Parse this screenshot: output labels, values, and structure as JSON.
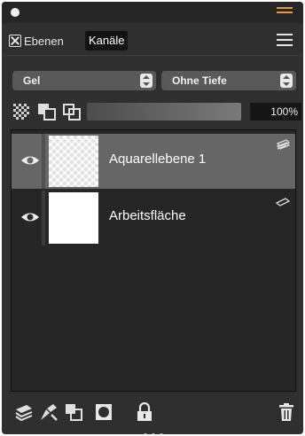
{
  "tabs": {
    "ebenen_label": "Ebenen",
    "kanaele_label": "Kanäle"
  },
  "blend": {
    "mode_value": "Gel",
    "depth_value": "Ohne Tiefe"
  },
  "opacity": {
    "value_label": "100%",
    "value": 100
  },
  "layers": [
    {
      "name": "Aquarellebene 1",
      "selected": true,
      "visible": true,
      "type_icon": "watercolor-layer-icon"
    },
    {
      "name": "Arbeitsfläche",
      "selected": false,
      "visible": true,
      "type_icon": "canvas-layer-icon"
    }
  ],
  "toolbar": {
    "icons": [
      "new-layer-icon",
      "layer-properties-icon",
      "duplicate-layer-icon",
      "mask-icon",
      "lock-icon",
      "delete-icon"
    ]
  },
  "colors": {
    "accent": "#e89a2c",
    "panel_bg": "#2f2f2f",
    "selected_row": "#666666"
  }
}
